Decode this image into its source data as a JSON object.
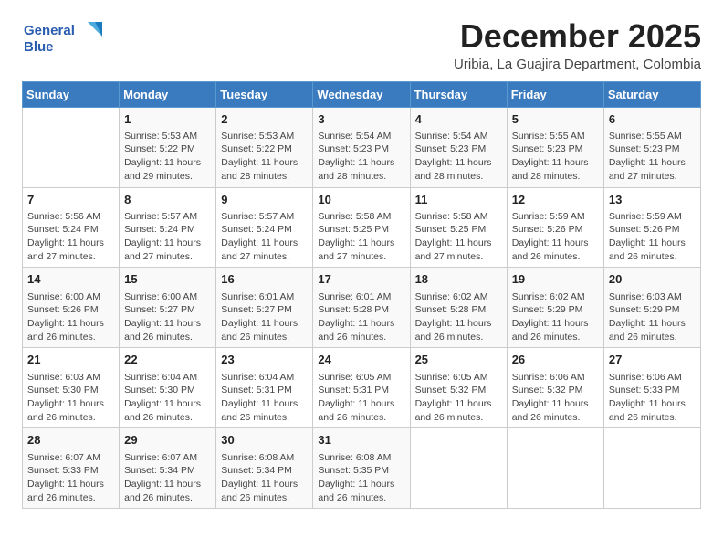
{
  "logo": {
    "line1": "General",
    "line2": "Blue"
  },
  "title": "December 2025",
  "subtitle": "Uribia, La Guajira Department, Colombia",
  "header_days": [
    "Sunday",
    "Monday",
    "Tuesday",
    "Wednesday",
    "Thursday",
    "Friday",
    "Saturday"
  ],
  "weeks": [
    [
      {
        "day": "",
        "info": ""
      },
      {
        "day": "1",
        "info": "Sunrise: 5:53 AM\nSunset: 5:22 PM\nDaylight: 11 hours\nand 29 minutes."
      },
      {
        "day": "2",
        "info": "Sunrise: 5:53 AM\nSunset: 5:22 PM\nDaylight: 11 hours\nand 28 minutes."
      },
      {
        "day": "3",
        "info": "Sunrise: 5:54 AM\nSunset: 5:23 PM\nDaylight: 11 hours\nand 28 minutes."
      },
      {
        "day": "4",
        "info": "Sunrise: 5:54 AM\nSunset: 5:23 PM\nDaylight: 11 hours\nand 28 minutes."
      },
      {
        "day": "5",
        "info": "Sunrise: 5:55 AM\nSunset: 5:23 PM\nDaylight: 11 hours\nand 28 minutes."
      },
      {
        "day": "6",
        "info": "Sunrise: 5:55 AM\nSunset: 5:23 PM\nDaylight: 11 hours\nand 27 minutes."
      }
    ],
    [
      {
        "day": "7",
        "info": "Sunrise: 5:56 AM\nSunset: 5:24 PM\nDaylight: 11 hours\nand 27 minutes."
      },
      {
        "day": "8",
        "info": "Sunrise: 5:57 AM\nSunset: 5:24 PM\nDaylight: 11 hours\nand 27 minutes."
      },
      {
        "day": "9",
        "info": "Sunrise: 5:57 AM\nSunset: 5:24 PM\nDaylight: 11 hours\nand 27 minutes."
      },
      {
        "day": "10",
        "info": "Sunrise: 5:58 AM\nSunset: 5:25 PM\nDaylight: 11 hours\nand 27 minutes."
      },
      {
        "day": "11",
        "info": "Sunrise: 5:58 AM\nSunset: 5:25 PM\nDaylight: 11 hours\nand 27 minutes."
      },
      {
        "day": "12",
        "info": "Sunrise: 5:59 AM\nSunset: 5:26 PM\nDaylight: 11 hours\nand 26 minutes."
      },
      {
        "day": "13",
        "info": "Sunrise: 5:59 AM\nSunset: 5:26 PM\nDaylight: 11 hours\nand 26 minutes."
      }
    ],
    [
      {
        "day": "14",
        "info": "Sunrise: 6:00 AM\nSunset: 5:26 PM\nDaylight: 11 hours\nand 26 minutes."
      },
      {
        "day": "15",
        "info": "Sunrise: 6:00 AM\nSunset: 5:27 PM\nDaylight: 11 hours\nand 26 minutes."
      },
      {
        "day": "16",
        "info": "Sunrise: 6:01 AM\nSunset: 5:27 PM\nDaylight: 11 hours\nand 26 minutes."
      },
      {
        "day": "17",
        "info": "Sunrise: 6:01 AM\nSunset: 5:28 PM\nDaylight: 11 hours\nand 26 minutes."
      },
      {
        "day": "18",
        "info": "Sunrise: 6:02 AM\nSunset: 5:28 PM\nDaylight: 11 hours\nand 26 minutes."
      },
      {
        "day": "19",
        "info": "Sunrise: 6:02 AM\nSunset: 5:29 PM\nDaylight: 11 hours\nand 26 minutes."
      },
      {
        "day": "20",
        "info": "Sunrise: 6:03 AM\nSunset: 5:29 PM\nDaylight: 11 hours\nand 26 minutes."
      }
    ],
    [
      {
        "day": "21",
        "info": "Sunrise: 6:03 AM\nSunset: 5:30 PM\nDaylight: 11 hours\nand 26 minutes."
      },
      {
        "day": "22",
        "info": "Sunrise: 6:04 AM\nSunset: 5:30 PM\nDaylight: 11 hours\nand 26 minutes."
      },
      {
        "day": "23",
        "info": "Sunrise: 6:04 AM\nSunset: 5:31 PM\nDaylight: 11 hours\nand 26 minutes."
      },
      {
        "day": "24",
        "info": "Sunrise: 6:05 AM\nSunset: 5:31 PM\nDaylight: 11 hours\nand 26 minutes."
      },
      {
        "day": "25",
        "info": "Sunrise: 6:05 AM\nSunset: 5:32 PM\nDaylight: 11 hours\nand 26 minutes."
      },
      {
        "day": "26",
        "info": "Sunrise: 6:06 AM\nSunset: 5:32 PM\nDaylight: 11 hours\nand 26 minutes."
      },
      {
        "day": "27",
        "info": "Sunrise: 6:06 AM\nSunset: 5:33 PM\nDaylight: 11 hours\nand 26 minutes."
      }
    ],
    [
      {
        "day": "28",
        "info": "Sunrise: 6:07 AM\nSunset: 5:33 PM\nDaylight: 11 hours\nand 26 minutes."
      },
      {
        "day": "29",
        "info": "Sunrise: 6:07 AM\nSunset: 5:34 PM\nDaylight: 11 hours\nand 26 minutes."
      },
      {
        "day": "30",
        "info": "Sunrise: 6:08 AM\nSunset: 5:34 PM\nDaylight: 11 hours\nand 26 minutes."
      },
      {
        "day": "31",
        "info": "Sunrise: 6:08 AM\nSunset: 5:35 PM\nDaylight: 11 hours\nand 26 minutes."
      },
      {
        "day": "",
        "info": ""
      },
      {
        "day": "",
        "info": ""
      },
      {
        "day": "",
        "info": ""
      }
    ]
  ]
}
